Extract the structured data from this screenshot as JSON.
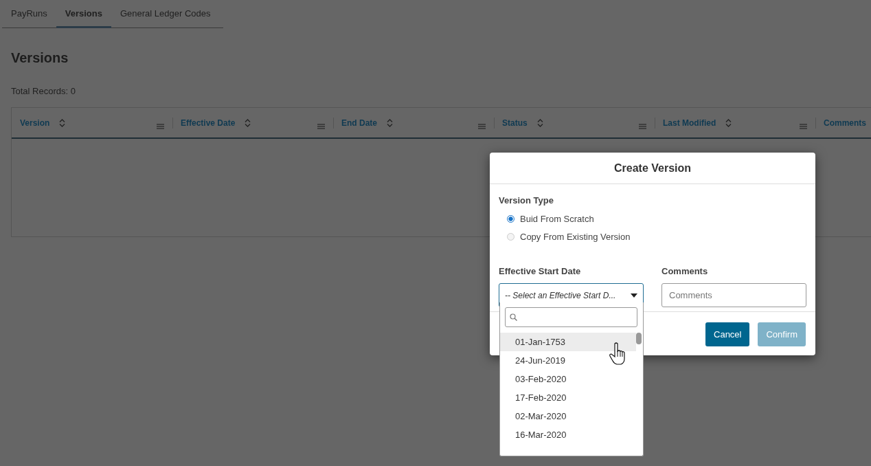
{
  "tabs": [
    {
      "label": "PayRuns",
      "selected": false
    },
    {
      "label": "Versions",
      "selected": true
    },
    {
      "label": "General Ledger Codes",
      "selected": false
    }
  ],
  "page_title": "Versions",
  "total_records": "Total Records: 0",
  "table": {
    "columns": [
      {
        "label": "Version"
      },
      {
        "label": "Effective Date"
      },
      {
        "label": "End Date"
      },
      {
        "label": "Status"
      },
      {
        "label": "Last Modified"
      },
      {
        "label": "Comments"
      }
    ]
  },
  "modal": {
    "title": "Create Version",
    "version_type": {
      "label": "Version Type",
      "options": [
        {
          "label": "Buid From Scratch",
          "selected": true
        },
        {
          "label": "Copy From Existing Version",
          "selected": false
        }
      ]
    },
    "start_date": {
      "label": "Effective Start Date",
      "value": "-- Select an Effective Start D...",
      "expanded": true
    },
    "comments": {
      "label": "Comments",
      "placeholder": "Comments"
    },
    "buttons": [
      {
        "label": "Cancel",
        "disabled": false
      },
      {
        "label": "Confirm",
        "disabled": true
      }
    ]
  },
  "dropdown": {
    "items": [
      {
        "label": "01-Jan-1753",
        "highlighted": true
      },
      {
        "label": "24-Jun-2019",
        "highlighted": false
      },
      {
        "label": "03-Feb-2020",
        "highlighted": false
      },
      {
        "label": "17-Feb-2020",
        "highlighted": false
      },
      {
        "label": "02-Mar-2020",
        "highlighted": false
      },
      {
        "label": "16-Mar-2020",
        "highlighted": false
      }
    ]
  }
}
